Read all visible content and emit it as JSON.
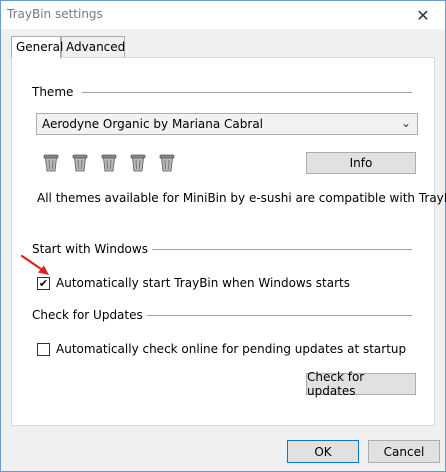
{
  "window": {
    "title": "TrayBin settings",
    "close_glyph": "✕"
  },
  "tabs": [
    {
      "label": "General",
      "active": true
    },
    {
      "label": "Advanced",
      "active": false
    }
  ],
  "theme": {
    "group_label": "Theme",
    "selected": "Aerodyne Organic by Mariana Cabral",
    "chevron_glyph": "⌄",
    "preview_icons": [
      "trash-bin-icon",
      "trash-bin-icon",
      "trash-bin-icon",
      "trash-bin-icon",
      "trash-bin-icon"
    ],
    "info_label": "Info",
    "note": "All themes available for MiniBin by e-sushi are compatible with TrayBin"
  },
  "startup": {
    "group_label": "Start with Windows",
    "auto_start_label": "Automatically start TrayBin when Windows starts",
    "auto_start_checked": true,
    "check_glyph": "✔"
  },
  "updates": {
    "group_label": "Check for Updates",
    "auto_check_label": "Automatically check online for pending updates at startup",
    "auto_check_checked": false,
    "check_button_label": "Check for updates"
  },
  "footer": {
    "ok_label": "OK",
    "cancel_label": "Cancel"
  },
  "colors": {
    "window_border": "#6a9bd1",
    "annotation_arrow": "#e02020",
    "focus_border": "#0078d7"
  }
}
